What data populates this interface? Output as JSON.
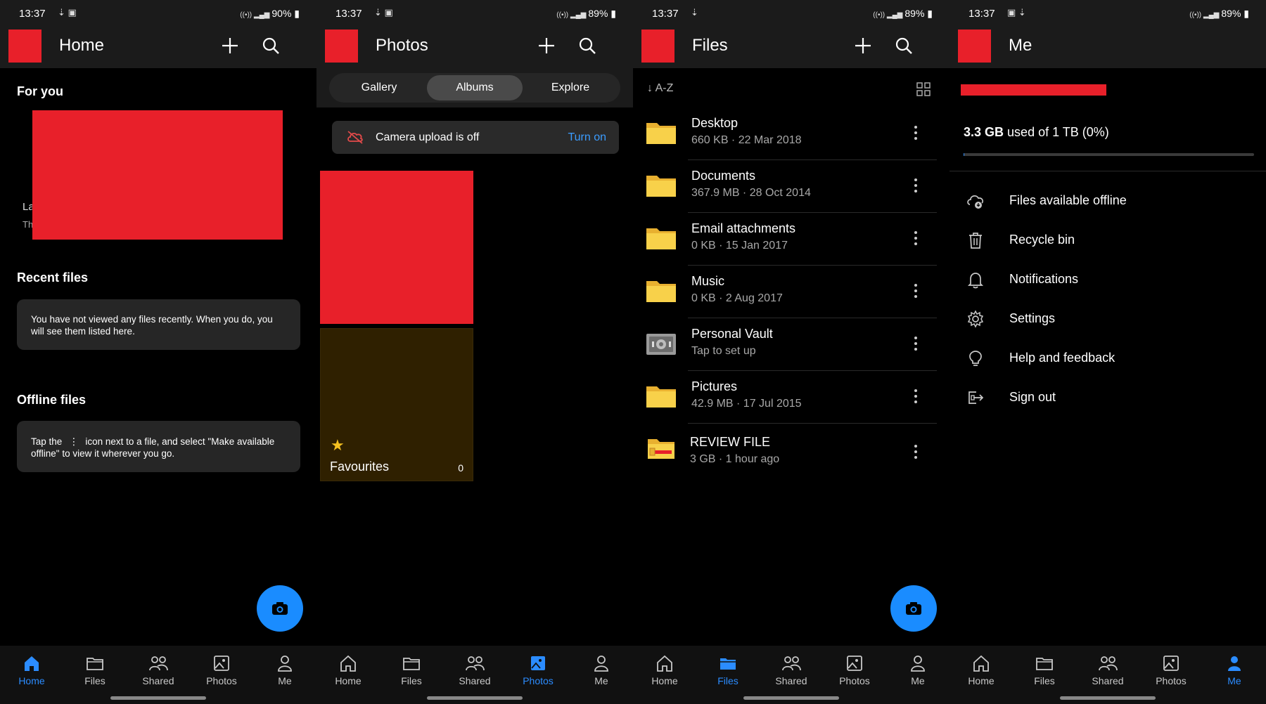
{
  "status": {
    "time": "13:37",
    "battery_s1": "90%",
    "battery_other": "89%",
    "signal": "VoLTE"
  },
  "nav": {
    "home": "Home",
    "files": "Files",
    "shared": "Shared",
    "photos": "Photos",
    "me": "Me"
  },
  "accent": "#2b8cff",
  "home": {
    "title": "Home",
    "for_you": "For you",
    "recent_title": "Recent files",
    "recent_msg": "You have not viewed any files recently. When you do, you will see them listed here.",
    "offline_title": "Offline files",
    "offline_msg_a": "Tap the",
    "offline_msg_b": "icon next to a file, and select \"Make available offline\" to view it wherever you go.",
    "partial_a": "La",
    "partial_b": "Th"
  },
  "photos": {
    "title": "Photos",
    "tabs": [
      "Gallery",
      "Albums",
      "Explore"
    ],
    "banner_text": "Camera upload is off",
    "banner_action": "Turn on",
    "fav_name": "Favourites",
    "fav_count": "0"
  },
  "files": {
    "title": "Files",
    "sort": "A-Z",
    "items": [
      {
        "name": "Desktop",
        "meta": "660 KB · 22 Mar 2018",
        "icon": "folder-icon"
      },
      {
        "name": "Documents",
        "meta": "367.9 MB · 28 Oct 2014",
        "icon": "folder-icon"
      },
      {
        "name": "Email attachments",
        "meta": "0 KB · 15 Jan 2017",
        "icon": "folder-icon"
      },
      {
        "name": "Music",
        "meta": "0 KB · 2 Aug 2017",
        "icon": "folder-icon"
      },
      {
        "name": "Personal Vault",
        "meta": "Tap to set up",
        "icon": "vault-icon"
      },
      {
        "name": "Pictures",
        "meta": "42.9 MB · 17 Jul 2015",
        "icon": "folder-icon"
      },
      {
        "name": "REVIEW FILE",
        "meta": "3 GB · 1 hour ago",
        "icon": "shared-folder-icon"
      }
    ]
  },
  "me": {
    "title": "Me",
    "storage_used": "3.3 GB",
    "storage_rest": "used of 1 TB (0%)",
    "storage_fraction": 0.003,
    "items": [
      {
        "label": "Files available offline",
        "icon": "cloud-offline-icon"
      },
      {
        "label": "Recycle bin",
        "icon": "trash-icon"
      },
      {
        "label": "Notifications",
        "icon": "bell-icon"
      },
      {
        "label": "Settings",
        "icon": "gear-icon"
      },
      {
        "label": "Help and feedback",
        "icon": "lightbulb-icon"
      },
      {
        "label": "Sign out",
        "icon": "sign-out-icon"
      }
    ]
  }
}
